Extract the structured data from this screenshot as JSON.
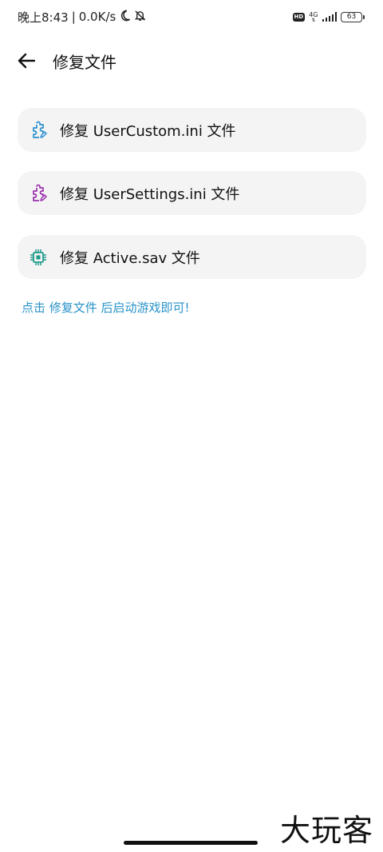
{
  "status_bar": {
    "time": "晚上8:43",
    "separator": "|",
    "speed": "0.0K/s",
    "hd": "HD",
    "network": "4G",
    "battery": "63"
  },
  "header": {
    "title": "修复文件"
  },
  "items": [
    {
      "label": "修复 UserCustom.ini 文件",
      "icon": "puzzle-edit-icon",
      "color": "#2a8fd0"
    },
    {
      "label": "修复 UserSettings.ini 文件",
      "icon": "puzzle-edit-icon",
      "color": "#9b2fae"
    },
    {
      "label": "修复 Active.sav 文件",
      "icon": "chip-icon",
      "color": "#1f9a8a"
    }
  ],
  "hint": "点击 修复文件 后启动游戏即可!",
  "watermark": "大玩客",
  "colors": {
    "hint": "#2a93c9",
    "card_bg": "#f4f4f4"
  }
}
